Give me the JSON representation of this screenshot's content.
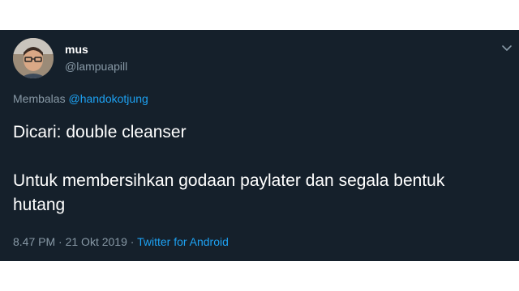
{
  "tweet": {
    "author_name": "mus",
    "author_handle": "@lampuapill",
    "reply_prefix": "Membalas",
    "reply_to": "@handokotjung",
    "text_line1": "Dicari: double cleanser",
    "text_line2": "Untuk membersihkan godaan paylater dan segala bentuk hutang",
    "time": "8.47 PM",
    "date": "21 Okt 2019",
    "source": "Twitter for Android",
    "separator": "·"
  },
  "icons": {
    "menu": "chevron-down-icon",
    "avatar": "avatar"
  },
  "colors": {
    "background": "#15202b",
    "text": "#ffffff",
    "secondary_text": "#8899a6",
    "link": "#1da1f2"
  }
}
